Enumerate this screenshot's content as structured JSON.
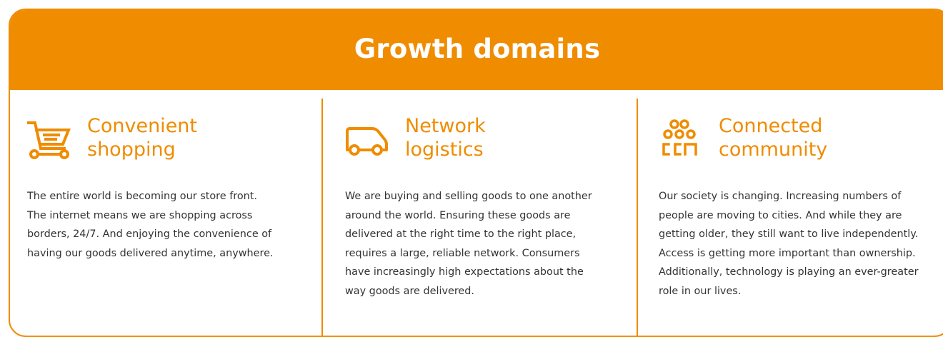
{
  "banner": {
    "title": "Growth domains"
  },
  "colors": {
    "accent": "#ef8c00",
    "text": "#333333",
    "background": "#ffffff"
  },
  "columns": [
    {
      "icon": "shopping-cart-icon",
      "title_lines": [
        "Convenient",
        "shopping"
      ],
      "body_lines": [
        "The entire world is becoming our store front.",
        "The internet means we are shopping across",
        "borders, 24/7. And enjoying the convenience of",
        "having our goods delivered anytime, anywhere."
      ]
    },
    {
      "icon": "delivery-van-icon",
      "title_lines": [
        "Network",
        "logistics"
      ],
      "body_lines": [
        "We are buying and selling goods to one another",
        "around the world. Ensuring these goods are",
        "delivered at the right time to the right place,",
        "requires a large, reliable network. Consumers",
        "have increasingly high expectations about the",
        "way goods are delivered."
      ]
    },
    {
      "icon": "community-people-icon",
      "title_lines": [
        "Connected",
        "community"
      ],
      "body_lines": [
        "Our society is changing. Increasing numbers of",
        "people are moving to cities. And while they are",
        "getting older, they still want to live independently.",
        "Access is getting more important than ownership.",
        "Additionally, technology is playing an ever-greater",
        "role in our lives."
      ]
    }
  ]
}
